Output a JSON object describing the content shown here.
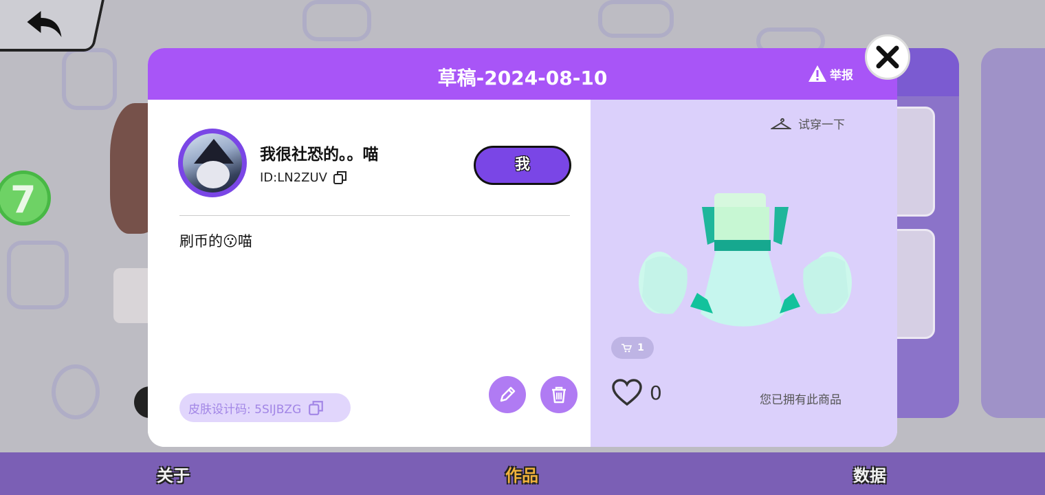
{
  "dialog": {
    "title": "草稿-2024-08-10",
    "report_label": "举报",
    "author": {
      "name": "我很社恐的。。喵",
      "id_text": "ID:LN2ZUV"
    },
    "me_button": "我",
    "description": "刷币的😗喵",
    "skin_code": "皮肤设计码: 5SIJBZG",
    "try_on_label": "试穿一下",
    "cart_count": "1",
    "like_count": "0",
    "owned_text": "您已拥有此商品"
  },
  "bottom_nav": {
    "tabs": [
      {
        "label": "关于",
        "active": false
      },
      {
        "label": "作品",
        "active": true
      },
      {
        "label": "数据",
        "active": false
      }
    ]
  },
  "background": {
    "badge_number": "7"
  },
  "colors": {
    "header": "#a855f7",
    "accent": "#7a46e6",
    "right_pane": "#dbd0fb",
    "active_tab": "#f0b23c"
  }
}
